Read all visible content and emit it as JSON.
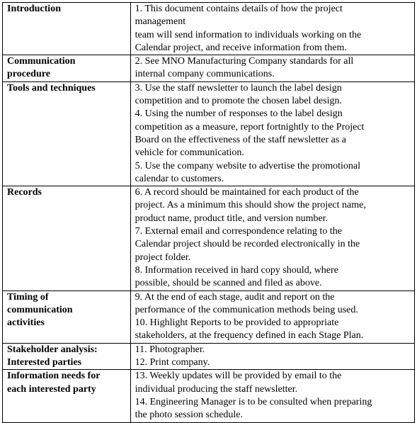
{
  "rows": [
    {
      "label": [
        "Introduction"
      ],
      "content": [
        "1. This document contains details of how the project",
        "management",
        "team will send information to individuals working on the",
        "Calendar project, and receive  information from them."
      ]
    },
    {
      "label": [
        "Communication",
        "procedure"
      ],
      "content": [
        "2. See MNO Manufacturing  Company standards for all",
        "internal company  communications."
      ]
    },
    {
      "label": [
        "Tools and techniques"
      ],
      "content": [
        "3. Use the staff newsletter to launch  the label  design",
        "competition and to promote the chosen label  design.",
        "4. Using the number  of responses to the label  design",
        "competition as a measure,  report fortnightly to the Project",
        "Board on the effectiveness of the staff newsletter as  a",
        "vehicle for communication.",
        "5. Use the company  website to advertise the promotional",
        "calendar to customers."
      ]
    },
    {
      "label": [
        "Records"
      ],
      "content": [
        "6. A record should be maintained for each product of the",
        "project. As a minimum  this should show the project name,",
        "product name, product title, and version  number.",
        "7. External email  and correspondence relating to the",
        "Calendar project should be recorded electronically  in the",
        "project folder.",
        "8. Information received in hard copy should, where",
        "possible, should be scanned and filed as  above."
      ]
    },
    {
      "label": [
        "Timing of",
        "communication",
        "activities"
      ],
      "content": [
        "9. At the end of each stage,  audit and report  on the",
        "performance of the communication  methods being used.",
        "10. Highlight Reports to be provided to appropriate",
        "stakeholders, at the frequency  defined in each Stage Plan."
      ]
    },
    {
      "label": [
        "Stakeholder analysis:",
        "Interested parties"
      ],
      "content": [
        "11. Photographer.",
        "12. Print company."
      ]
    },
    {
      "label": [
        "Information needs for",
        "each interested  party"
      ],
      "content": [
        "13. Weekly updates will be provided by email  to the",
        "individual producing the staff newsletter.",
        "14. Engineering  Manager is to be consulted when preparing",
        "the photo session  schedule."
      ]
    }
  ]
}
